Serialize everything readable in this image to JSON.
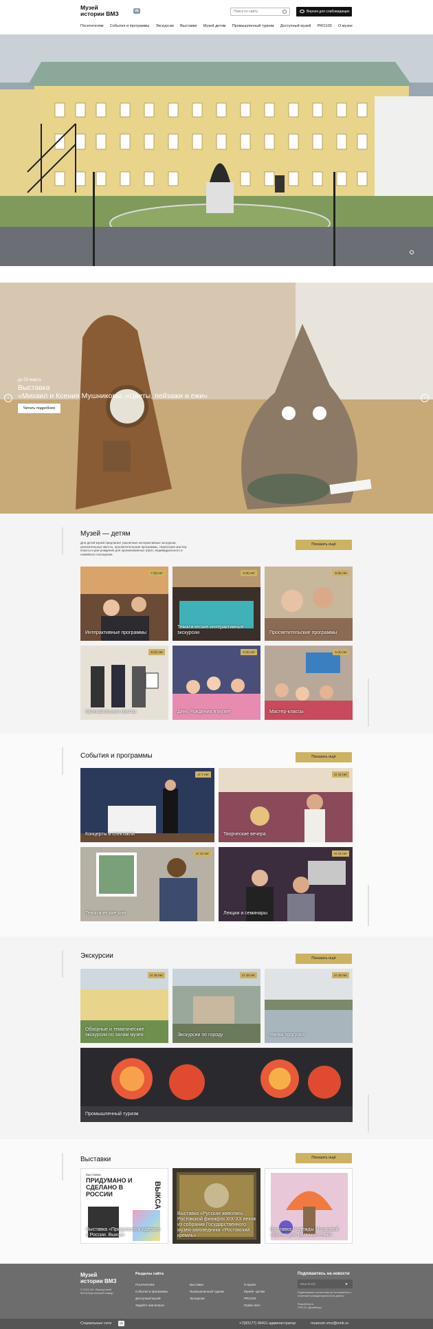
{
  "header": {
    "logo_line1": "Музей",
    "logo_line2": "истории ВМЗ",
    "vk_label": "vk",
    "search_placeholder": "Поиск по сайту",
    "accessible_label": "Версия для слабовидящих",
    "nav": [
      "Посетителям",
      "События и программы",
      "Экскурсии",
      "Выставки",
      "Музей детям",
      "Промышленный туризм",
      "Доступный музей",
      "PRO100",
      "О музее"
    ]
  },
  "slider": {
    "date": "до 20 марта",
    "title_line1": "Выставка",
    "title_line2": "«Михаил и Ксения Мушниковы. «Цветы, пейзажи и ежи»",
    "button": "Читать подробнее",
    "prev": "‹",
    "next": "›"
  },
  "children": {
    "title": "Музей — детям",
    "description": "Для детей музей предлагает различные интерактивные экскурсии, увлекательные квесты, просветительские программы, творческие мастер-классы и дни рождения для организованных групп, индивидуального и семейного посещения.",
    "more": "Показать ещё",
    "cards": [
      {
        "label": "Интерактивные программы",
        "badge": "7 (5) лет"
      },
      {
        "label": "Тематические интерактивные экскурсии",
        "badge": "5 (5) лет"
      },
      {
        "label": "Просветительские программы",
        "badge": "5 (6) лет"
      },
      {
        "label": "Увлекательные квесты",
        "badge": "8 (2) лет"
      },
      {
        "label": "День Рождения в музее",
        "badge": "5 (3) лет"
      },
      {
        "label": "Мастер-классы",
        "badge": "5 (2) лет"
      }
    ]
  },
  "events": {
    "title": "События и программы",
    "more": "Показать ещё",
    "cards": [
      {
        "label": "Концерты и спектакли",
        "badge": "от 7 лет"
      },
      {
        "label": "Творческие вечера",
        "badge": "от 14 лет"
      },
      {
        "label": "Тематические дни",
        "badge": "от 12 лет"
      },
      {
        "label": "Лекции и семинары",
        "badge": "от 12 лет"
      }
    ]
  },
  "excursions": {
    "title": "Экскурсии",
    "more": "Показать ещё",
    "cards": [
      {
        "label": "Обзорные и тематические экскурсии по залам музея",
        "badge": "от 16 лет"
      },
      {
        "label": "Экскурсии по городу",
        "badge": "от 16 лет"
      },
      {
        "label": "Умная прогулка",
        "badge": "от 18 лет"
      },
      {
        "label": "Промышленный туризм",
        "badge": ""
      }
    ]
  },
  "exhibitions": {
    "title": "Выставки",
    "more": "Показать ещё",
    "cards": [
      {
        "label": "Выставка «Придумано и сделано в России. Выкса»"
      },
      {
        "label": "Выставка «Русская живопись Ростовской финифти XIX-XX веков из собрания Государственного музея-заповедника «Ростовский кремль»"
      },
      {
        "label": "Выставка Надежды Мошковой «Время для размышлений»"
      }
    ],
    "poster_small": "ВЫСТАВКА",
    "poster_big": "ПРИДУМАНО И СДЕЛАНО В РОССИИ",
    "poster_side": "ВЫКСА"
  },
  "footer": {
    "logo_line1": "Музей",
    "logo_line2": "истории ВМЗ",
    "copyright": "© 2022 АО «Выксунский Металлургический завод»",
    "sections_title": "Разделы сайта",
    "col1": [
      "Посетителям",
      "События и программы",
      "Доступный музей",
      "Задайте нам вопрос"
    ],
    "col2": [
      "Выставки",
      "Промышленный туризм",
      "Экскурсии"
    ],
    "col3": [
      "О музее",
      "Музей—детям",
      "PRO100",
      "Прайс-лист"
    ],
    "subscribe_title": "Подпишитесь на новости",
    "email_placeholder": "Ваш Email",
    "send": "➤",
    "note": "Подписываясь на рассылку вы соглашаетесь с политикой конфиденциальности данных",
    "support_label": "Разработка в",
    "support_value": "ТОП-20: Дизайнеры",
    "social_label": "Социальные сети",
    "phone": "+7(83177) 96411 администратор",
    "email": "museum.vmz@omk.ru"
  },
  "colors": {
    "accent": "#cdb262",
    "footer": "#6d6d6d",
    "bar": "#555555"
  }
}
